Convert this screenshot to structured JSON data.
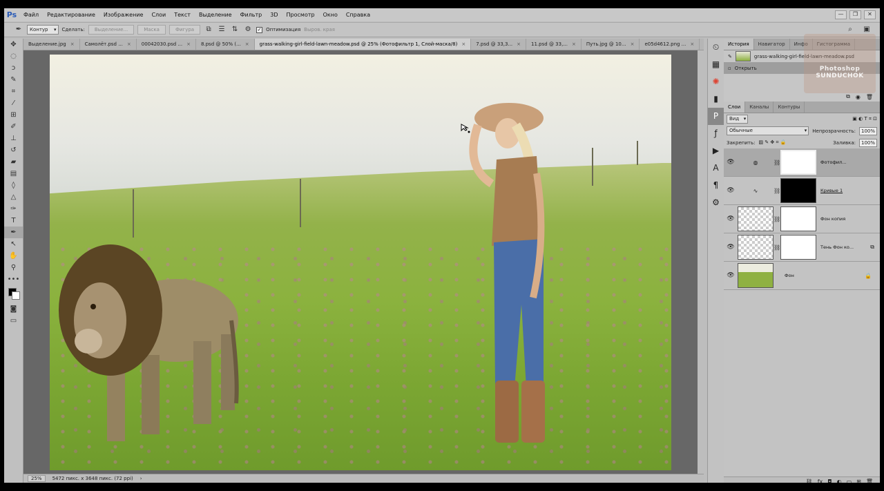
{
  "app": {
    "logo": "Ps"
  },
  "menu": [
    "Файл",
    "Редактирование",
    "Изображение",
    "Слои",
    "Текст",
    "Выделение",
    "Фильтр",
    "3D",
    "Просмотр",
    "Окно",
    "Справка"
  ],
  "window_controls": [
    "—",
    "❐",
    "✕"
  ],
  "options": {
    "mode": "Контур",
    "make_label": "Сделать:",
    "selection_btn": "Выделение...",
    "mask_btn": "Маска",
    "shape_btn": "Фигура",
    "optimize_label": "Оптимизация",
    "align_edges_label": "Выров. края"
  },
  "tabs": [
    {
      "label": "Выделение.jpg",
      "active": false
    },
    {
      "label": "Самолёт.psd ...",
      "active": false
    },
    {
      "label": "00042030.psd ...",
      "active": false
    },
    {
      "label": "8.psd @ 50% (...",
      "active": false
    },
    {
      "label": "grass-walking-girl-field-lawn-meadow.psd @ 25% (Фотофильтр 1, Слой-маска/8)",
      "active": true
    },
    {
      "label": "7.psd @ 33,3...",
      "active": false
    },
    {
      "label": "11.psd @ 33,...",
      "active": false
    },
    {
      "label": "Путь.jpg @ 10...",
      "active": false
    },
    {
      "label": "e05d4612.png ...",
      "active": false
    }
  ],
  "status": {
    "zoom": "25%",
    "doc_info": "5472 пикс. x 3648 пикс. (72 ppi)"
  },
  "history_panel": {
    "tabs": [
      "История",
      "Навигатор",
      "Инфо",
      "Гистограмма"
    ],
    "snapshot": "grass-walking-girl-field-lawn-meadow.psd",
    "steps": [
      "Открыть"
    ]
  },
  "watermark": {
    "line1": "Photoshop",
    "line2": "SUNDUCHOK"
  },
  "layers_panel": {
    "tabs": [
      "Слои",
      "Каналы",
      "Контуры"
    ],
    "filter_label": "Вид",
    "blend_mode": "Обычные",
    "opacity_label": "Непрозрачность:",
    "opacity": "100%",
    "lock_label": "Закрепить:",
    "fill_label": "Заливка:",
    "fill": "100%",
    "layers": [
      {
        "name": "Фотофил...",
        "selected": true
      },
      {
        "name": "Кривые 1",
        "selected": false
      },
      {
        "name": "Фон копия",
        "selected": false
      },
      {
        "name": "Тень Фон ко...",
        "selected": false
      },
      {
        "name": "Фон",
        "selected": false
      }
    ]
  }
}
